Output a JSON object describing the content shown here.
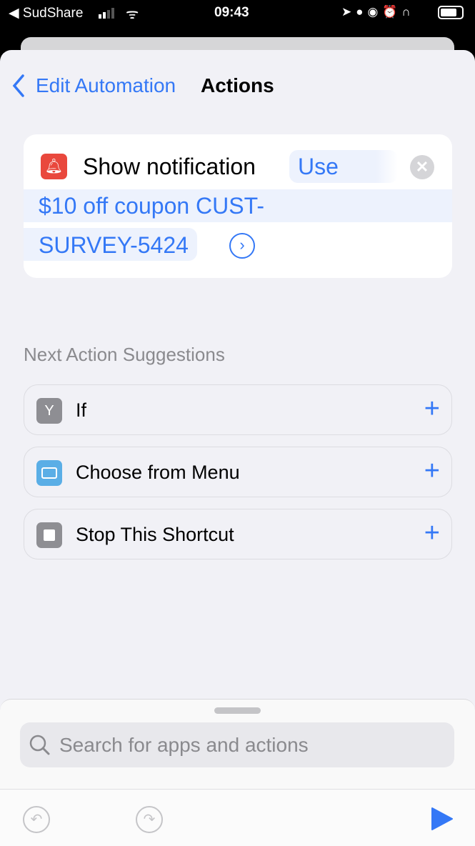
{
  "status_bar": {
    "carrier": "◀ SudShare",
    "time": "09:43"
  },
  "nav": {
    "back_label": "Edit Automation",
    "title": "Actions"
  },
  "action_card": {
    "title": "Show notification",
    "param_prefix": "Use",
    "message_line1": "$10 off coupon CUST-",
    "message_line2": "SURVEY-5424"
  },
  "suggestions": {
    "heading": "Next Action Suggestions",
    "items": [
      {
        "label": "If",
        "icon": "branch-icon",
        "color": "#8e8e93"
      },
      {
        "label": "Choose from Menu",
        "icon": "menu-icon",
        "color": "#5aaee6"
      },
      {
        "label": "Stop This Shortcut",
        "icon": "stop-icon",
        "color": "#8e8e93"
      }
    ]
  },
  "search": {
    "placeholder": "Search for apps and actions"
  },
  "colors": {
    "accent": "#3478f6",
    "notification_icon": "#e9483d"
  }
}
